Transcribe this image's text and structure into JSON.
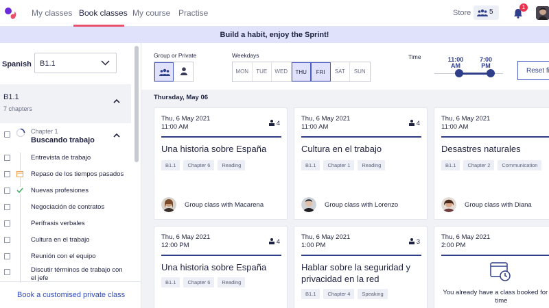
{
  "nav": {
    "tabs": [
      {
        "label": "My classes",
        "active": false
      },
      {
        "label": "Book classes",
        "active": true
      },
      {
        "label": "My course",
        "active": false
      },
      {
        "label": "Practise",
        "active": false
      }
    ],
    "store_label": "Store",
    "group_count": "5",
    "notification_count": "1",
    "accent_color": "#e8506b"
  },
  "banner": {
    "text": "Build a habit, enjoy the Sprint!"
  },
  "sidebar": {
    "language_label": "Spanish",
    "level_value": "B1.1",
    "level_card": {
      "title": "B1.1",
      "subtitle": "7 chapters"
    },
    "chapter": {
      "kicker": "Chapter 1",
      "title": "Buscando trabajo"
    },
    "lessons": [
      {
        "label": "Entrevista de trabajo",
        "icon": "none"
      },
      {
        "label": "Repaso de los tiempos pasados",
        "icon": "calendar-icon"
      },
      {
        "label": "Nuevas profesiones",
        "icon": "check-icon"
      },
      {
        "label": "Negociación de contratos",
        "icon": "none"
      },
      {
        "label": "Perífrasis verbales",
        "icon": "none"
      },
      {
        "label": "Cultura en el trabajo",
        "icon": "none"
      },
      {
        "label": "Reunión con el equipo",
        "icon": "none"
      },
      {
        "label": "Discutir términos de trabajo con el jefe",
        "icon": "none"
      }
    ],
    "book_private_label": "Book a customised private class"
  },
  "filters": {
    "group_private_label": "Group or Private",
    "weekdays_label": "Weekdays",
    "weekdays": [
      {
        "label": "MON",
        "selected": false
      },
      {
        "label": "TUE",
        "selected": false
      },
      {
        "label": "WED",
        "selected": false
      },
      {
        "label": "THU",
        "selected": true
      },
      {
        "label": "FRI",
        "selected": true
      },
      {
        "label": "SAT",
        "selected": false
      },
      {
        "label": "SUN",
        "selected": false
      }
    ],
    "time_label": "Time",
    "time_from": {
      "time": "11:00",
      "ampm": "AM"
    },
    "time_to": {
      "time": "7:00",
      "ampm": "PM"
    },
    "reset_label": "Reset filters"
  },
  "main": {
    "date_heading": "Thursday, May 06",
    "cards": [
      {
        "date": "Thu, 6 May 2021",
        "time": "11:00 AM",
        "seats": "4",
        "title": "Una historia sobre España",
        "tags": [
          "B1.1",
          "Chapter 6",
          "Reading"
        ],
        "teacher": "Group class with Macarena"
      },
      {
        "date": "Thu, 6 May 2021",
        "time": "11:00 AM",
        "seats": "4",
        "title": "Cultura en el trabajo",
        "tags": [
          "B1.1",
          "Chapter 1",
          "Reading"
        ],
        "teacher": "Group class with Lorenzo"
      },
      {
        "date": "Thu, 6 May 2021",
        "time": "11:00 AM",
        "seats": "",
        "title": "Desastres naturales",
        "tags": [
          "B1.1",
          "Chapter 2",
          "Communication"
        ],
        "teacher": "Group class with Diana"
      },
      {
        "date": "Thu, 6 May 2021",
        "time": "12:00 PM",
        "seats": "4",
        "title": "Una historia sobre España",
        "tags": [
          "B1.1",
          "Chapter 6",
          "Reading"
        ],
        "teacher": ""
      },
      {
        "date": "Thu, 6 May 2021",
        "time": "1:00 PM",
        "seats": "3",
        "title": "Hablar sobre la seguridad y privacidad en la red",
        "tags": [
          "B1.1",
          "Chapter 4",
          "Speaking"
        ],
        "teacher": ""
      },
      {
        "date": "Thu, 6 May 2021",
        "time": "2:00 PM",
        "seats": "",
        "title": "",
        "tags": [],
        "teacher": "",
        "booked_message": "You already have a class booked for this time"
      }
    ]
  }
}
